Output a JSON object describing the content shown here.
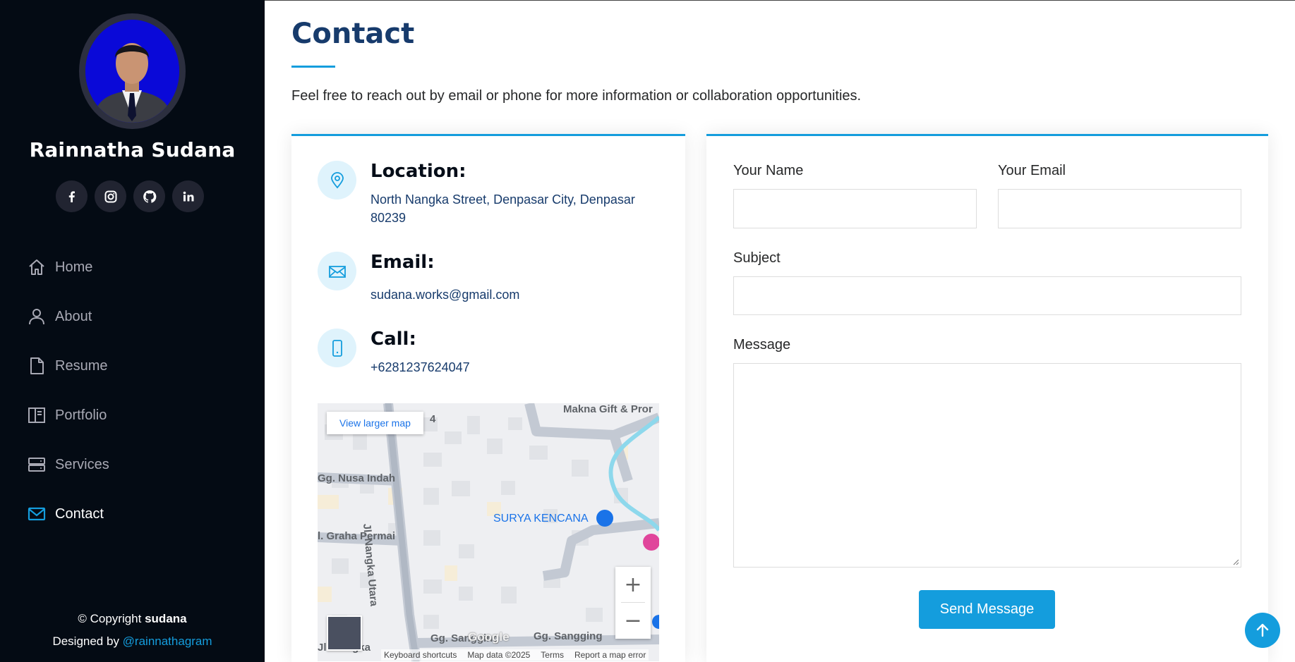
{
  "profile": {
    "name": "Rainnatha Sudana",
    "social": [
      "facebook-icon",
      "instagram-icon",
      "github-icon",
      "linkedin-icon"
    ]
  },
  "nav": {
    "items": [
      {
        "label": "Home",
        "icon": "home-icon"
      },
      {
        "label": "About",
        "icon": "person-icon"
      },
      {
        "label": "Resume",
        "icon": "file-icon"
      },
      {
        "label": "Portfolio",
        "icon": "book-icon"
      },
      {
        "label": "Services",
        "icon": "server-icon"
      },
      {
        "label": "Contact",
        "icon": "envelope-icon",
        "active": true
      }
    ]
  },
  "footer": {
    "copyright_prefix": "© Copyright ",
    "copyright_name": "sudana",
    "designed_prefix": "Designed by ",
    "designed_link": "@rainnathagram"
  },
  "contact": {
    "title": "Contact",
    "intro": "Feel free to reach out by email or phone for more information or collaboration opportunities.",
    "location_heading": "Location:",
    "location_text": "North Nangka Street, Denpasar City, Denpasar 80239",
    "email_heading": "Email:",
    "email_text": "sudana.works@gmail.com",
    "call_heading": "Call:",
    "call_text": "+6281237624047"
  },
  "map": {
    "view_larger": "View larger map",
    "labels": {
      "makna": "Makna Gift & Pror",
      "num4": "4",
      "nusa_indah": "Gg. Nusa Indah",
      "graha_permai": "l. Graha Permai",
      "nangka_utara": "Jl. Nangka Utara",
      "surya_kencana": "SURYA KENCANA",
      "sangging1": "Gg. Sangging",
      "sangging2": "Gg. Sangging",
      "nangka_bottom": "Jl. Nangka"
    },
    "google": "Google",
    "footer": {
      "shortcuts": "Keyboard shortcuts",
      "data": "Map data ©2025",
      "terms": "Terms",
      "report": "Report a map error"
    },
    "zoom_in": "+",
    "zoom_out": "−"
  },
  "form": {
    "name_label": "Your Name",
    "email_label": "Your Email",
    "subject_label": "Subject",
    "message_label": "Message",
    "submit": "Send Message"
  },
  "colors": {
    "accent": "#149ddd",
    "sidebar_bg": "#040b14",
    "title": "#173b6c"
  }
}
